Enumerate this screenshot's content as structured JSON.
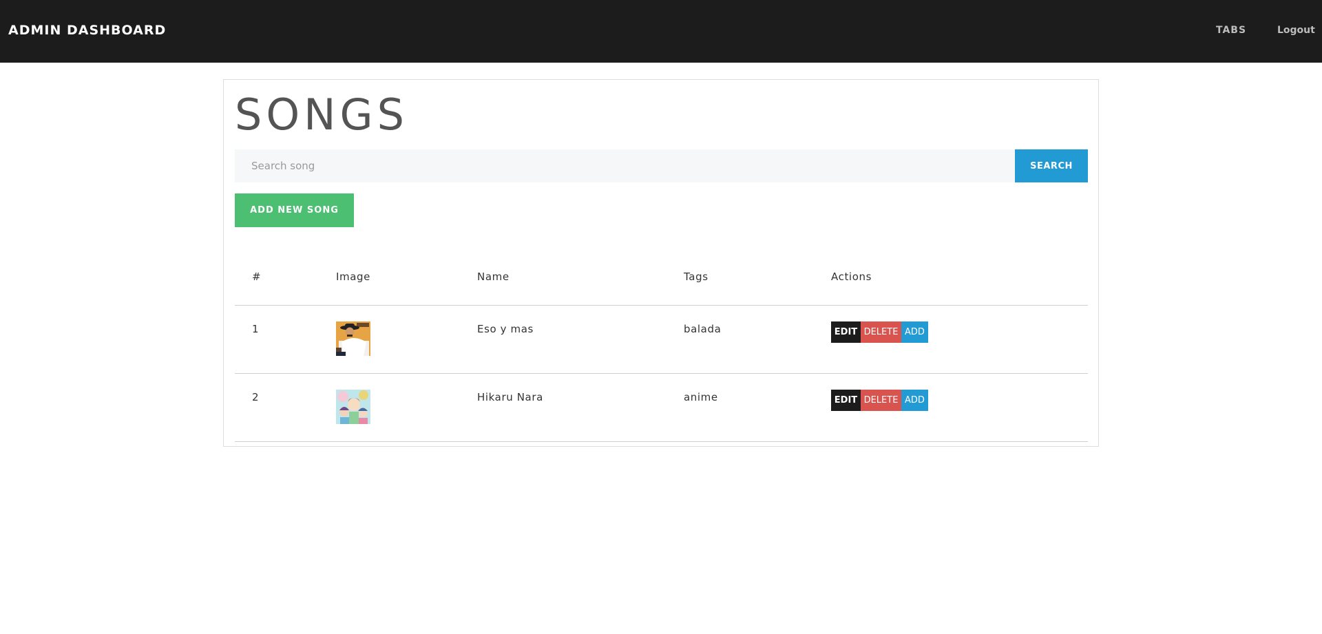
{
  "navbar": {
    "brand": "ADMIN DASHBOARD",
    "links": [
      {
        "label": "TABS"
      },
      {
        "label": "Logout"
      }
    ]
  },
  "main": {
    "title": "SONGS",
    "search": {
      "placeholder": "Search song",
      "value": "",
      "button_label": "SEARCH"
    },
    "add_button_label": "ADD NEW SONG",
    "table": {
      "headers": [
        "#",
        "Image",
        "Name",
        "Tags",
        "Actions"
      ],
      "rows": [
        {
          "num": "1",
          "image": "album-cover-cowboy",
          "name": "Eso y mas",
          "tags": "balada",
          "actions": [
            "EDIT",
            "DELETE",
            "ADD"
          ]
        },
        {
          "num": "2",
          "image": "album-cover-anime",
          "name": "Hikaru Nara",
          "tags": "anime",
          "actions": [
            "EDIT",
            "DELETE",
            "ADD"
          ]
        }
      ]
    }
  },
  "colors": {
    "navbar_bg": "#1c1c1c",
    "search_button": "#229bd4",
    "add_button": "#4cbf73",
    "edit_button": "#1c1c1c",
    "delete_button": "#d9534f",
    "add_action_button": "#229bd4"
  }
}
